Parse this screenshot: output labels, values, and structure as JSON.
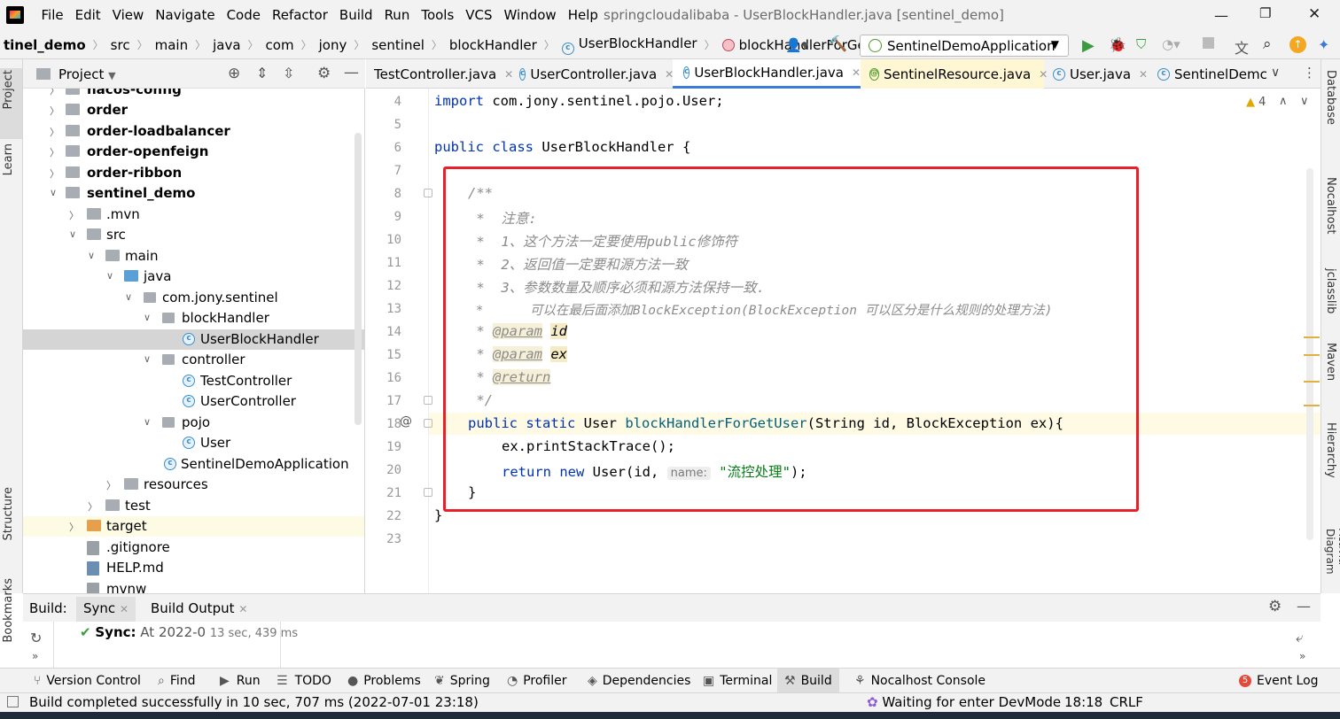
{
  "menu": {
    "items": [
      "File",
      "Edit",
      "View",
      "Navigate",
      "Code",
      "Refactor",
      "Build",
      "Run",
      "Tools",
      "VCS",
      "Window",
      "Help"
    ],
    "window_title": "springcloudalibaba - UserBlockHandler.java [sentinel_demo]"
  },
  "breadcrumb": [
    "tinel_demo",
    "src",
    "main",
    "java",
    "com",
    "jony",
    "sentinel",
    "blockHandler",
    "UserBlockHandler",
    "blockHandlerForGetUser"
  ],
  "run_config": "SentinelDemoApplication",
  "left_strip": {
    "project": "Project",
    "learn": "Learn",
    "structure": "Structure",
    "bookmarks": "Bookmarks"
  },
  "project_panel": {
    "title": "Project",
    "tree": [
      {
        "label": "nacos-config",
        "bold": true
      },
      {
        "label": "order",
        "bold": true
      },
      {
        "label": "order-loadbalancer",
        "bold": true
      },
      {
        "label": "order-openfeign",
        "bold": true
      },
      {
        "label": "order-ribbon",
        "bold": true
      },
      {
        "label": "sentinel_demo",
        "bold": true
      },
      {
        "label": ".mvn"
      },
      {
        "label": "src"
      },
      {
        "label": "main"
      },
      {
        "label": "java"
      },
      {
        "label": "com.jony.sentinel"
      },
      {
        "label": "blockHandler"
      },
      {
        "label": "UserBlockHandler"
      },
      {
        "label": "controller"
      },
      {
        "label": "TestController"
      },
      {
        "label": "UserController"
      },
      {
        "label": "pojo"
      },
      {
        "label": "User"
      },
      {
        "label": "SentinelDemoApplication"
      },
      {
        "label": "resources"
      },
      {
        "label": "test"
      },
      {
        "label": "target"
      },
      {
        "label": ".gitignore"
      },
      {
        "label": "HELP.md"
      },
      {
        "label": "mvnw"
      }
    ]
  },
  "tabs": [
    "TestController.java",
    "UserController.java",
    "UserBlockHandler.java",
    "SentinelResource.java",
    "User.java",
    "SentinelDemc"
  ],
  "editor": {
    "warnings": "4",
    "line_numbers": [
      "4",
      "5",
      "6",
      "7",
      "8",
      "9",
      "10",
      "11",
      "12",
      "13",
      "14",
      "15",
      "16",
      "17",
      "18",
      "19",
      "20",
      "21",
      "22",
      "23"
    ],
    "import_line": "com.jony.sentinel.pojo.User;",
    "class_decl": "UserBlockHandler {",
    "comment_open": "/**",
    "note": " *  注意:",
    "rule1": " *  1、这个方法一定要使用public修饰符",
    "rule2": " *  2、返回值一定要和源方法一致",
    "rule3": " *  3、参数数量及顺序必须和源方法保持一致.",
    "rule4": " *      可以在最后面添加BlockException(BlockException 可以区分是什么规则的处理方法)",
    "param1": "id",
    "param2": "ex",
    "at_param": "@param",
    "at_return": "@return",
    "comment_close": " */",
    "method_name": "blockHandlerForGetUser",
    "method_params": "(String id, BlockException ex){",
    "stmt1": "ex.printStackTrace();",
    "stmt2_a": "User(id, ",
    "hint_name": "name:",
    "stmt2_str": "\"流控处理\"",
    "stmt2_end": ");",
    "close1": "}",
    "close2": "}"
  },
  "right_strip": [
    "Database",
    "Nocalhost",
    "jclasslib",
    "Maven",
    "Hierarchy",
    "BPMN-Activiti-Diagram"
  ],
  "build": {
    "label": "Build:",
    "tab_sync": "Sync",
    "tab_output": "Build Output",
    "sync_status": "Sync:",
    "sync_time": "At 2022-0",
    "sync_duration": "13 sec, 439 ms"
  },
  "tool_windows": [
    "Version Control",
    "Find",
    "Run",
    "TODO",
    "Problems",
    "Spring",
    "Profiler",
    "Dependencies",
    "Terminal",
    "Build",
    "Nocalhost Console"
  ],
  "status": {
    "message": "Build completed successfully in 10 sec, 707 ms (2022-07-01 23:18)",
    "devmode": "Waiting for enter DevMode",
    "position": "18:18",
    "line_sep": "CRLF",
    "event_log": "Event Log",
    "event_count": "5"
  }
}
